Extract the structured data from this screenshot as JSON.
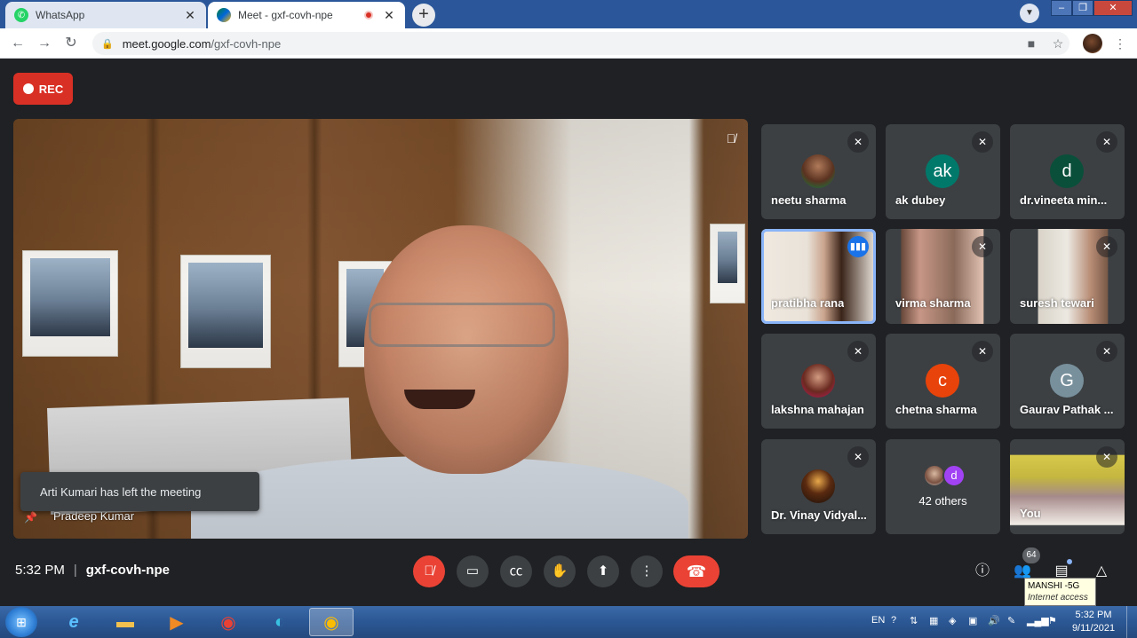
{
  "browser": {
    "tabs": [
      {
        "title": "WhatsApp"
      },
      {
        "title": "Meet - gxf-covh-npe"
      }
    ],
    "new_tab_symbol": "+",
    "url_host": "meet.google.com",
    "url_path": "/gxf-covh-npe"
  },
  "meet": {
    "rec_label": "REC",
    "main_speaker_name": "Pradeep Kumar",
    "toast_text": "Arti Kumari has left the meeting",
    "participants": [
      {
        "name": "neetu sharma",
        "avatar": "",
        "avatar_color": "#0b8043"
      },
      {
        "name": "ak dubey",
        "avatar": "ak",
        "avatar_color": "#00796b"
      },
      {
        "name": "dr.vineeta min...",
        "avatar": "d",
        "avatar_color": "#0a4f3a"
      },
      {
        "name": "pratibha rana"
      },
      {
        "name": "virma sharma"
      },
      {
        "name": "suresh tewari"
      },
      {
        "name": "lakshna mahajan",
        "avatar": "",
        "avatar_color": "#c2185b"
      },
      {
        "name": "chetna sharma",
        "avatar": "c",
        "avatar_color": "#e8430a"
      },
      {
        "name": "Gaurav Pathak ...",
        "avatar": "G",
        "avatar_color": "#78909c"
      },
      {
        "name": "Dr. Vinay Vidyal...",
        "avatar": "",
        "avatar_color": "#2b1b12"
      },
      {
        "name": "42 others",
        "avatar2": "d"
      },
      {
        "name": "You"
      }
    ],
    "time": "5:32 PM",
    "separator": "|",
    "meeting_code": "gxf-covh-npe",
    "people_count": "64"
  },
  "tooltip": {
    "line1": "MANSHI -5G",
    "line2": "Internet access"
  },
  "taskbar": {
    "lang": "EN",
    "clock_time": "5:32 PM",
    "clock_date": "9/11/2021"
  },
  "colors": {
    "meet_bg": "#202124",
    "tile_bg": "#3c4043",
    "danger": "#ea4335",
    "speaking_outline": "#8ab4f8"
  }
}
